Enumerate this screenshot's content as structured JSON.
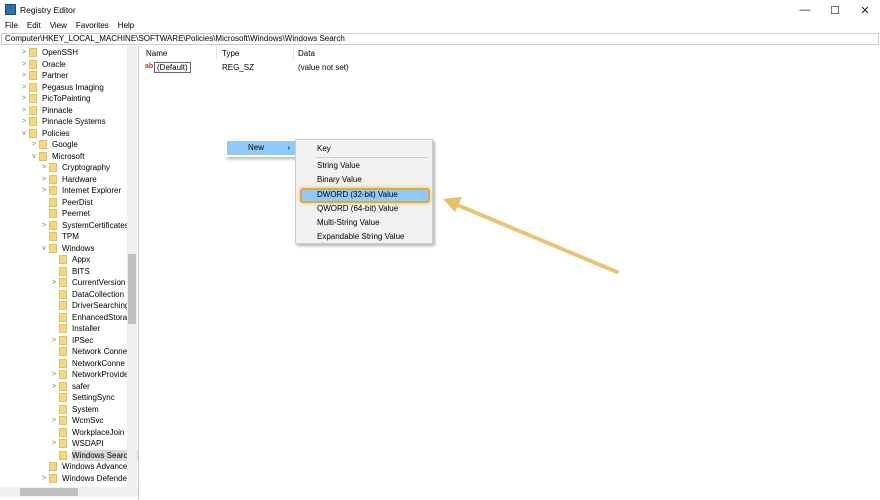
{
  "window": {
    "title": "Registry Editor",
    "minimize": "—",
    "maximize": "☐",
    "close": "✕"
  },
  "menu": [
    "File",
    "Edit",
    "View",
    "Favorites",
    "Help"
  ],
  "address": "Computer\\HKEY_LOCAL_MACHINE\\SOFTWARE\\Policies\\Microsoft\\Windows\\Windows Search",
  "tree": [
    {
      "label": "OpenSSH",
      "level": 0,
      "chev": ">"
    },
    {
      "label": "Oracle",
      "level": 0,
      "chev": ">"
    },
    {
      "label": "Partner",
      "level": 0,
      "chev": ">"
    },
    {
      "label": "Pegasus Imaging",
      "level": 0,
      "chev": ">"
    },
    {
      "label": "PicToPainting",
      "level": 0,
      "chev": ">"
    },
    {
      "label": "Pinnacle",
      "level": 0,
      "chev": ">"
    },
    {
      "label": "Pinnacle Systems",
      "level": 0,
      "chev": ">"
    },
    {
      "label": "Policies",
      "level": 0,
      "chev": "v"
    },
    {
      "label": "Google",
      "level": 1,
      "chev": ">"
    },
    {
      "label": "Microsoft",
      "level": 1,
      "chev": "v"
    },
    {
      "label": "Cryptography",
      "level": 2,
      "chev": ">"
    },
    {
      "label": "Hardware",
      "level": 2,
      "chev": ">"
    },
    {
      "label": "Internet Explorer",
      "level": 2,
      "chev": ">"
    },
    {
      "label": "PeerDist",
      "level": 2,
      "chev": ""
    },
    {
      "label": "Peernet",
      "level": 2,
      "chev": ""
    },
    {
      "label": "SystemCertificates",
      "level": 2,
      "chev": ">"
    },
    {
      "label": "TPM",
      "level": 2,
      "chev": ""
    },
    {
      "label": "Windows",
      "level": 2,
      "chev": "v"
    },
    {
      "label": "Appx",
      "level": 3,
      "chev": ""
    },
    {
      "label": "BITS",
      "level": 3,
      "chev": ""
    },
    {
      "label": "CurrentVersion",
      "level": 3,
      "chev": ">"
    },
    {
      "label": "DataCollection",
      "level": 3,
      "chev": ""
    },
    {
      "label": "DriverSearching",
      "level": 3,
      "chev": ""
    },
    {
      "label": "EnhancedStorag",
      "level": 3,
      "chev": ""
    },
    {
      "label": "Installer",
      "level": 3,
      "chev": ""
    },
    {
      "label": "IPSec",
      "level": 3,
      "chev": ">"
    },
    {
      "label": "Network Conne",
      "level": 3,
      "chev": ""
    },
    {
      "label": "NetworkConne",
      "level": 3,
      "chev": ""
    },
    {
      "label": "NetworkProvide",
      "level": 3,
      "chev": ">"
    },
    {
      "label": "safer",
      "level": 3,
      "chev": ">"
    },
    {
      "label": "SettingSync",
      "level": 3,
      "chev": ""
    },
    {
      "label": "System",
      "level": 3,
      "chev": ""
    },
    {
      "label": "WcmSvc",
      "level": 3,
      "chev": ">"
    },
    {
      "label": "WorkplaceJoin",
      "level": 3,
      "chev": ""
    },
    {
      "label": "WSDAPI",
      "level": 3,
      "chev": ">"
    },
    {
      "label": "Windows Search",
      "level": 3,
      "chev": "",
      "selected": true
    },
    {
      "label": "Windows Advance",
      "level": 2,
      "chev": ""
    },
    {
      "label": "Windows Defender",
      "level": 2,
      "chev": ">"
    }
  ],
  "columns": {
    "name": "Name",
    "type": "Type",
    "data": "Data"
  },
  "values": [
    {
      "icon": "ab",
      "name": "(Default)",
      "type": "REG_SZ",
      "data": "(value not set)"
    }
  ],
  "context": {
    "new": "New",
    "arrow": "›"
  },
  "submenu": [
    "Key",
    "String Value",
    "Binary Value",
    "DWORD (32-bit) Value",
    "QWORD (64-bit) Value",
    "Multi-String Value",
    "Expandable String Value"
  ],
  "highlight_color": "#d8ad44"
}
